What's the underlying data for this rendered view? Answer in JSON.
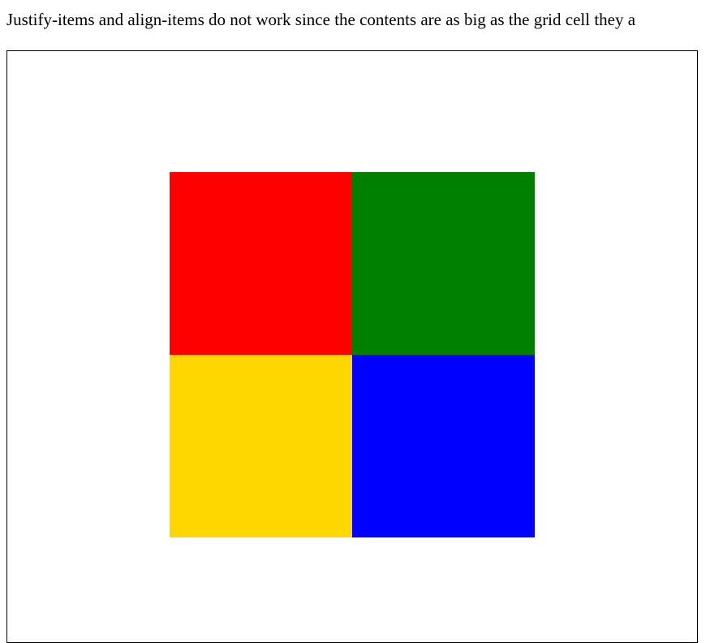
{
  "caption": "Justify-items and align-items do not work since the contents are as big as the grid cell they a",
  "grid": {
    "cells": [
      {
        "name": "red",
        "color": "#ff0000"
      },
      {
        "name": "green",
        "color": "#008000"
      },
      {
        "name": "gold",
        "color": "#ffd700"
      },
      {
        "name": "blue",
        "color": "#0000ff"
      }
    ]
  }
}
